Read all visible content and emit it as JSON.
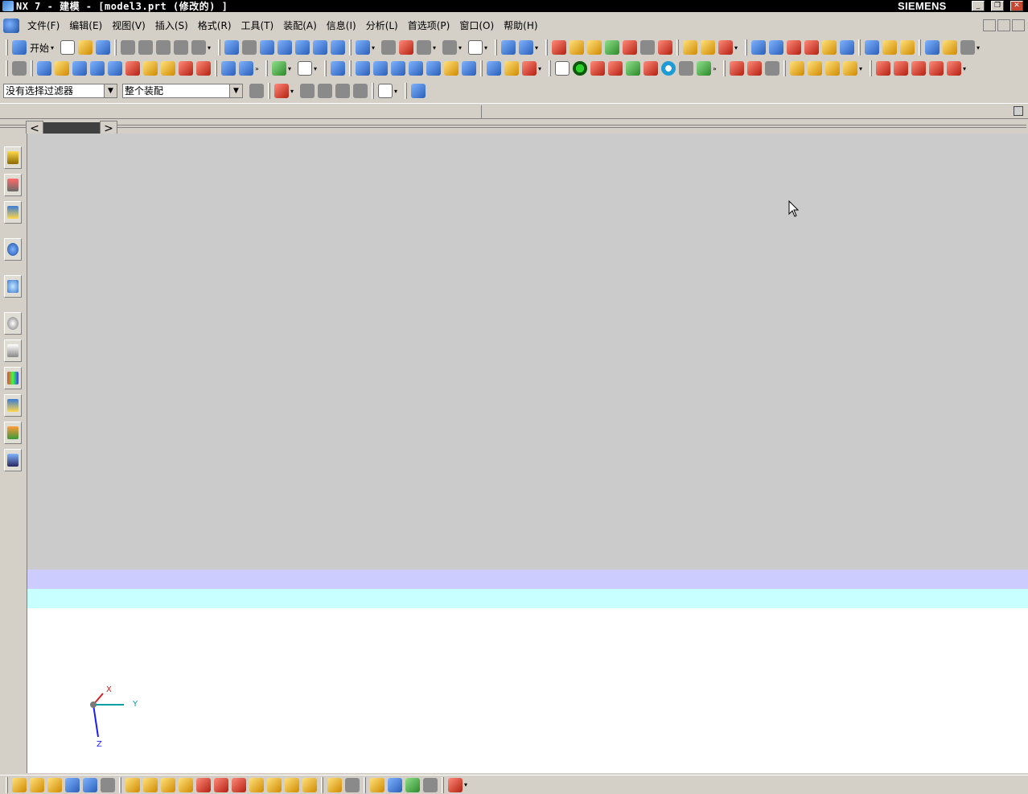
{
  "window": {
    "title": "NX 7 - 建模 - [model3.prt (修改的) ]",
    "brand": "SIEMENS",
    "minimize_label": "_",
    "maximize_label": "❐",
    "close_label": "✕"
  },
  "menubar": {
    "items": [
      {
        "label": "文件(F)"
      },
      {
        "label": "编辑(E)"
      },
      {
        "label": "视图(V)"
      },
      {
        "label": "插入(S)"
      },
      {
        "label": "格式(R)"
      },
      {
        "label": "工具(T)"
      },
      {
        "label": "装配(A)"
      },
      {
        "label": "信息(I)"
      },
      {
        "label": "分析(L)"
      },
      {
        "label": "首选项(P)"
      },
      {
        "label": "窗口(O)"
      },
      {
        "label": "帮助(H)"
      }
    ]
  },
  "toolbar": {
    "start_label": "开始",
    "filter_value": "没有选择过滤器",
    "scope_value": "整个装配",
    "more_label": "»"
  },
  "tabs": {
    "prev_label": "<",
    "next_label": ">"
  },
  "triad": {
    "x_label": "X",
    "y_label": "Y",
    "z_label": "Z"
  },
  "colors": {
    "background_top": "#cbcbcb",
    "band_lavender": "#ccccff",
    "band_cyan": "#c8ffff",
    "background_bottom": "#ffffff"
  }
}
